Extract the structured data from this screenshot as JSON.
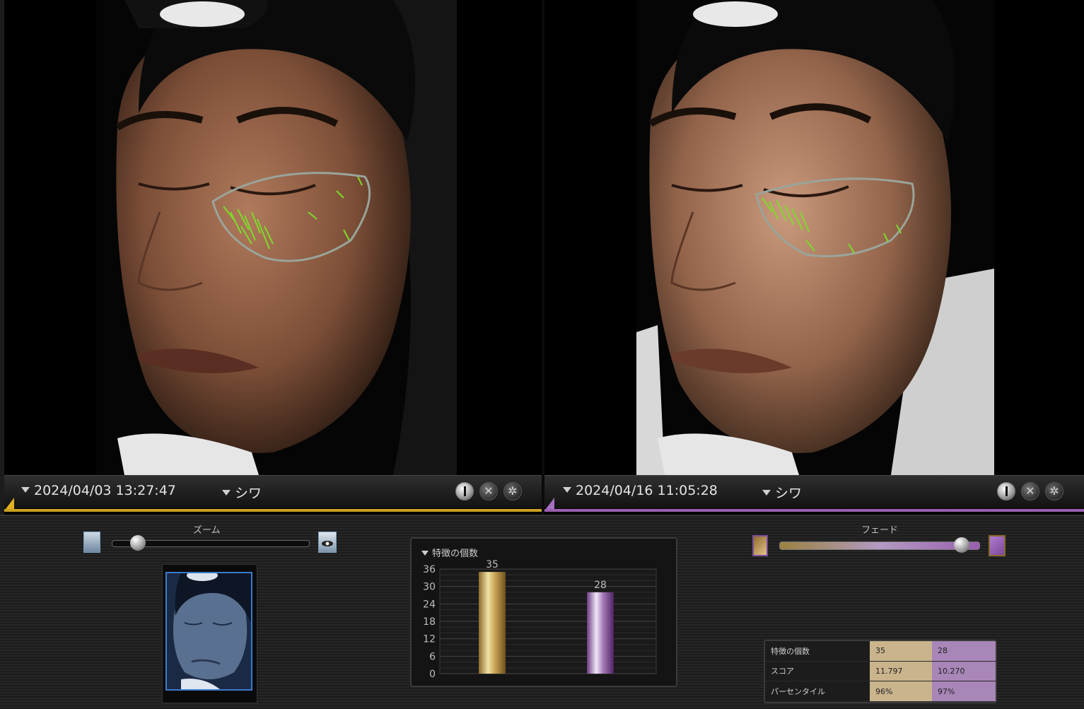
{
  "left_panel": {
    "datetime": "2024/04/03 13:27:47",
    "mode": "シワ",
    "accent_color": "#c9a020"
  },
  "right_panel": {
    "datetime": "2024/04/16 11:05:28",
    "mode": "シワ",
    "accent_color": "#9a5fb0"
  },
  "zoom": {
    "label": "ズーム",
    "level": 0.1
  },
  "fade": {
    "label": "フェード",
    "level": 0.95
  },
  "chart_data": {
    "type": "bar",
    "title": "特徴の個数",
    "categories": [
      "2024/04/03 13:27:47",
      "2024/04/16 11:05:28"
    ],
    "values": [
      35,
      28
    ],
    "colors": [
      "#c9a456",
      "#a67ab8"
    ],
    "yticks": [
      0,
      6,
      12,
      18,
      24,
      30,
      36
    ],
    "ylim": [
      0,
      36
    ],
    "grid": true
  },
  "stats": {
    "rows": [
      {
        "label": "特徴の個数",
        "v1": "35",
        "v2": "28"
      },
      {
        "label": "スコア",
        "v1": "11.797",
        "v2": "10.270"
      },
      {
        "label": "パーセンタイル",
        "v1": "96%",
        "v2": "97%"
      }
    ]
  }
}
